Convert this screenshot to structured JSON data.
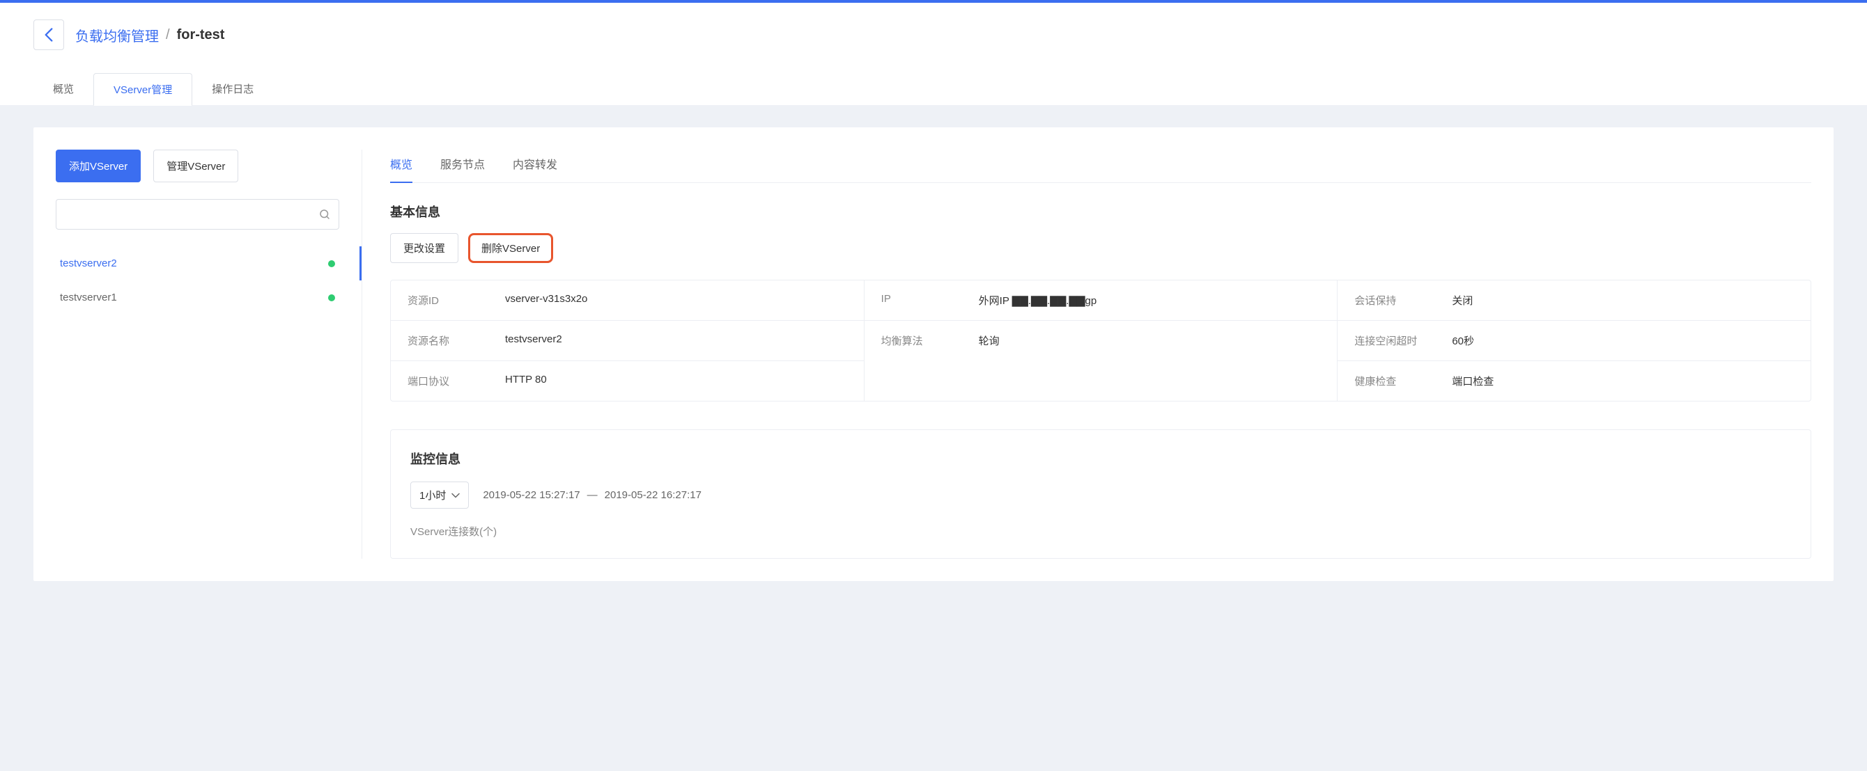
{
  "breadcrumb": {
    "root": "负载均衡管理",
    "sep": "/",
    "current": "for-test"
  },
  "mainTabs": [
    {
      "label": "概览",
      "active": false
    },
    {
      "label": "VServer管理",
      "active": true
    },
    {
      "label": "操作日志",
      "active": false
    }
  ],
  "sidebar": {
    "addBtn": "添加VServer",
    "manageBtn": "管理VServer",
    "searchPlaceholder": "",
    "items": [
      {
        "name": "testvserver2",
        "active": true
      },
      {
        "name": "testvserver1",
        "active": false
      }
    ]
  },
  "subTabs": [
    {
      "label": "概览",
      "active": true
    },
    {
      "label": "服务节点",
      "active": false
    },
    {
      "label": "内容转发",
      "active": false
    }
  ],
  "basic": {
    "title": "基本信息",
    "editBtn": "更改设置",
    "deleteBtn": "删除VServer",
    "cols": [
      [
        {
          "label": "资源ID",
          "value": "vserver-v31s3x2o"
        },
        {
          "label": "资源名称",
          "value": "testvserver2"
        },
        {
          "label": "端口协议",
          "value": "HTTP 80"
        }
      ],
      [
        {
          "label": "IP",
          "value": "外网IP ▇▇.▇▇.▇▇.▇▇gp"
        },
        {
          "label": "均衡算法",
          "value": "轮询"
        }
      ],
      [
        {
          "label": "会话保持",
          "value": "关闭"
        },
        {
          "label": "连接空闲超时",
          "value": "60秒"
        },
        {
          "label": "健康检查",
          "value": "端口检查"
        }
      ]
    ]
  },
  "monitor": {
    "title": "监控信息",
    "timeOption": "1小时",
    "rangeStart": "2019-05-22 15:27:17",
    "rangeSep": "—",
    "rangeEnd": "2019-05-22 16:27:17",
    "chartLabel": "VServer连接数(个)"
  }
}
